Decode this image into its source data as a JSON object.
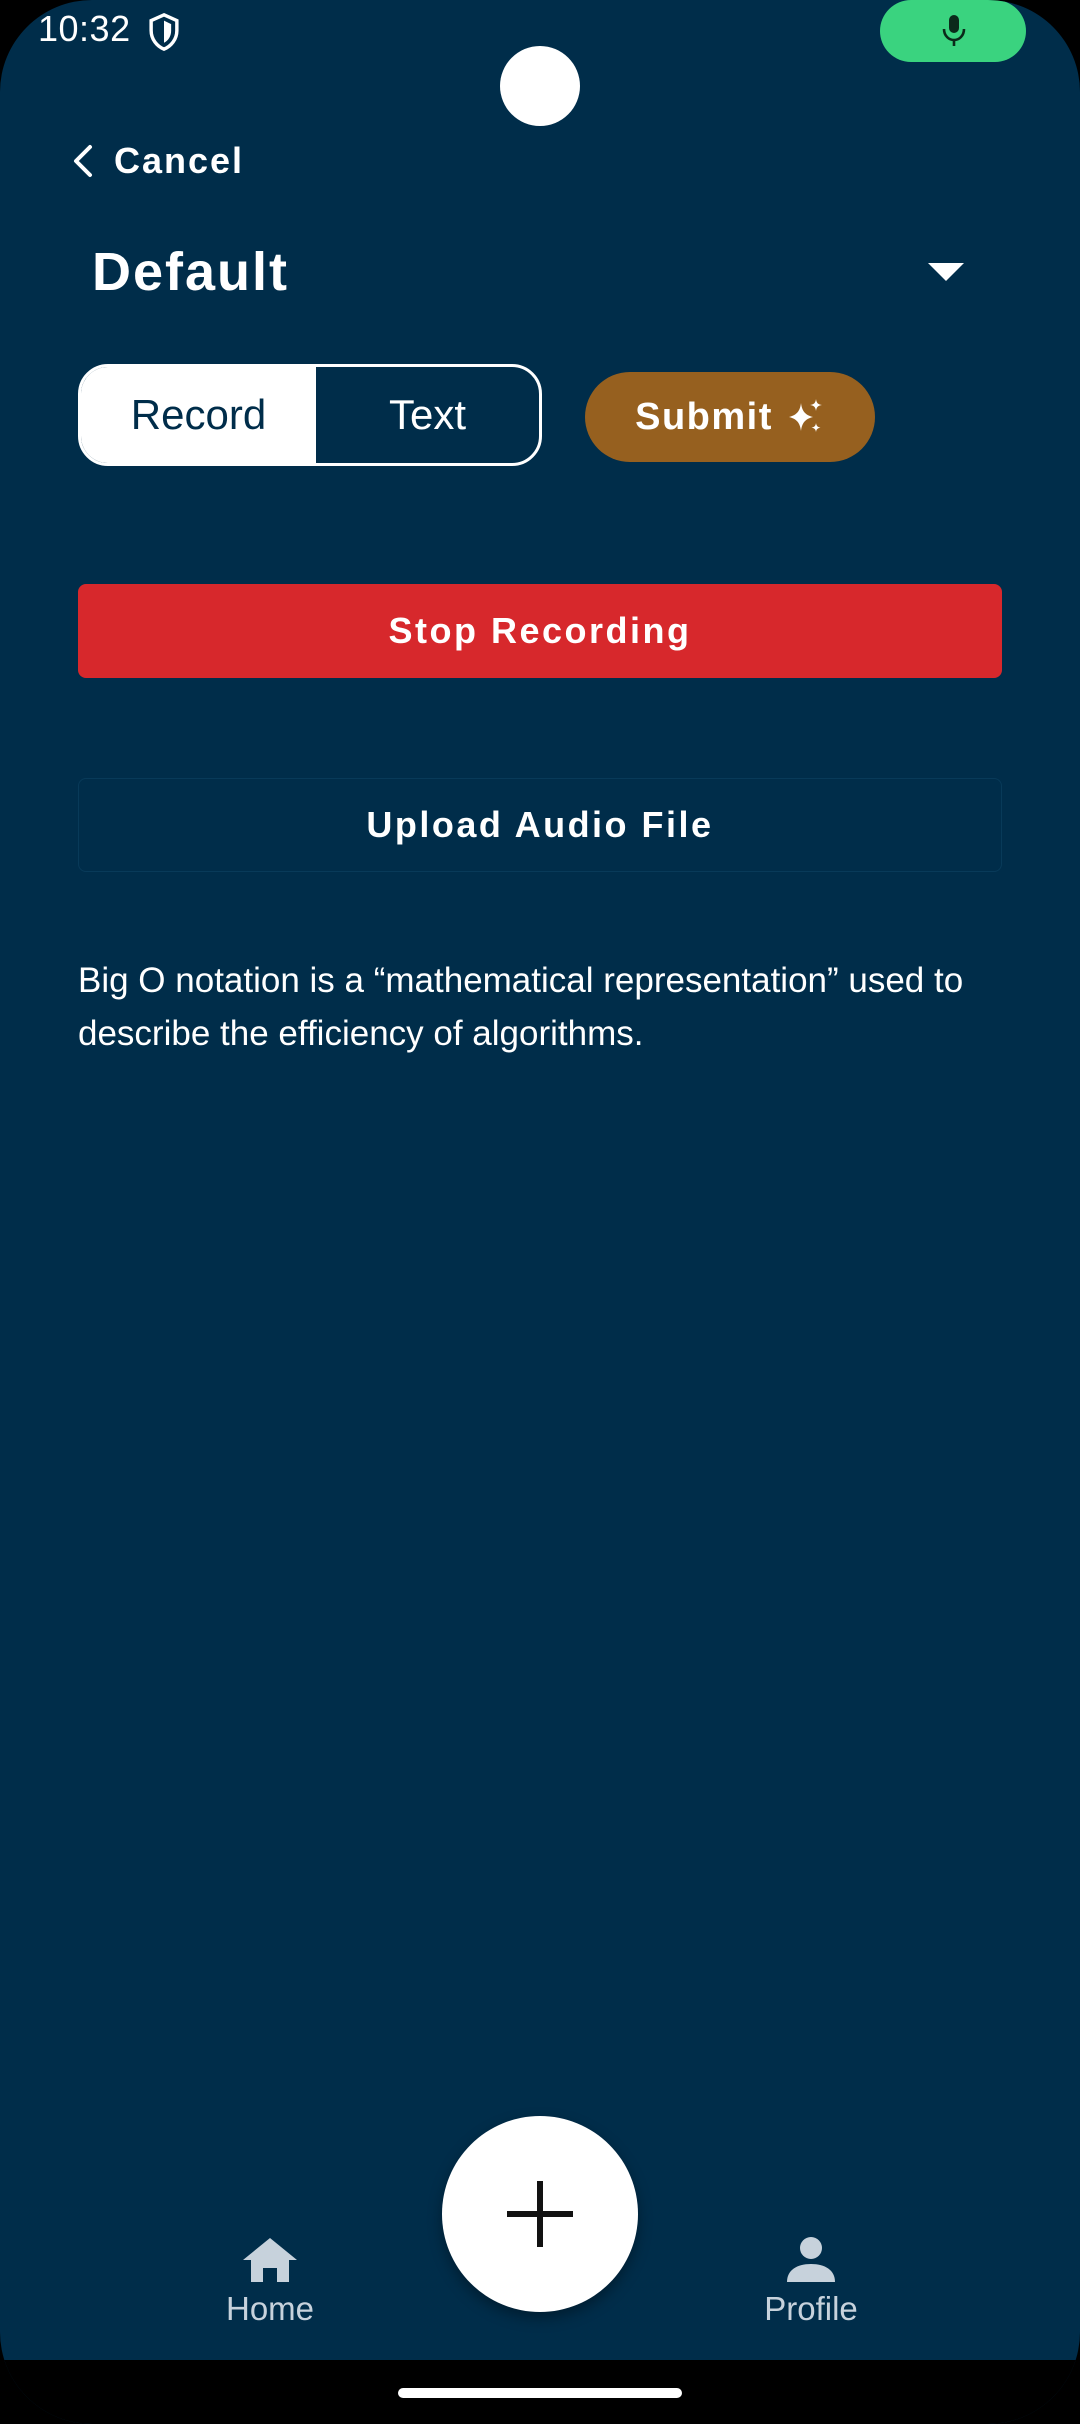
{
  "status_bar": {
    "time": "10:32",
    "shield_icon": "shield-icon",
    "mic_icon": "microphone-icon",
    "mic_indicator_color": "#3ad37f"
  },
  "header": {
    "cancel_label": "Cancel",
    "title": "Default"
  },
  "mode_toggle": {
    "options": [
      "Record",
      "Text"
    ],
    "selected": "Record"
  },
  "submit": {
    "label": "Submit",
    "icon": "sparkle-icon",
    "color": "#96601f"
  },
  "actions": {
    "stop_recording_label": "Stop Recording",
    "stop_color": "#d7282c",
    "upload_label": "Upload Audio File"
  },
  "transcript": {
    "text": "Big O notation is a “mathematical representation” used to describe the efficiency of algorithms."
  },
  "bottom_nav": {
    "items": [
      {
        "label": "Home",
        "icon": "home-icon"
      },
      {
        "label": "Profile",
        "icon": "person-icon"
      }
    ],
    "fab_icon": "plus-icon"
  },
  "colors": {
    "background": "#002d4a"
  }
}
